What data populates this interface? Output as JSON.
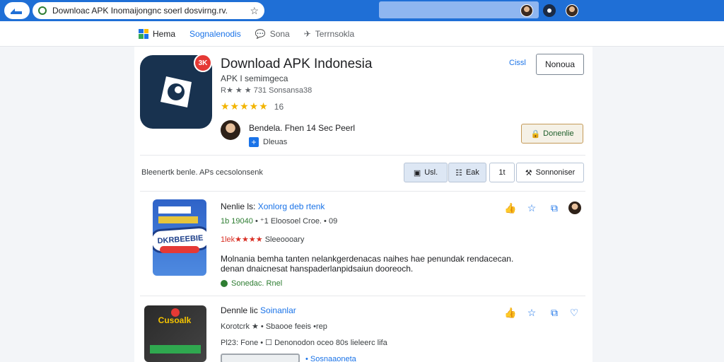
{
  "browser": {
    "url_text": "Downloac APK Inomaijongnc soerl dosvirng.rv.",
    "bookmark_icon": "star-icon"
  },
  "nav": {
    "items": [
      "Hema",
      "Sognalenodis",
      "Sona",
      "Terrnsokla"
    ]
  },
  "app": {
    "title": "Download APK Indonesia",
    "subtitle": "APK I semimgeca",
    "meta": "R★ ★ ★ 731 Sonsansa38",
    "stars": "★★★★★",
    "rating": "16",
    "badge": "3K",
    "developer": "Bendela. Fhen 14 Sec Peerl",
    "developer_tag": "Dleuas",
    "link": "Cissl",
    "primary_button": "Nonoua",
    "secondary_button": "Donenlie"
  },
  "filters": {
    "description": "Bleenertk benle. APs cecsolonsenk",
    "chips": [
      "Usl.",
      "Eak",
      "1t",
      "Sonnoniser"
    ]
  },
  "items": [
    {
      "title": "Nenlie ls:",
      "title_blue": "Xonlorg deb rtenk",
      "line1_green": "1b 19040",
      "line1": "• ⁺1 Eloosoel Croe. • 09",
      "line2_red": "1lek★★★★",
      "line2": "Sleeoooary",
      "desc": "Molnania bemha tanten nelankgerdenacas naihes hae penundak rendacecan. denan dnaicnesat hanspaderlanpidsaiun dooreoch.",
      "ok": "Sonedac. Rnel",
      "thumb_label": "DKRBEEBIE"
    },
    {
      "title": "Dennle lic",
      "title_blue": "Soinanlar",
      "line1": "Korotcrk ★ • Sbaooe feeis •rep",
      "line2": "Pl23: Fone • ☐ Denonodon oceo 80s lieleerc lifa",
      "line3_blue": "• Sosnaaoneta",
      "thumb_label": "Cusoalk"
    }
  ]
}
